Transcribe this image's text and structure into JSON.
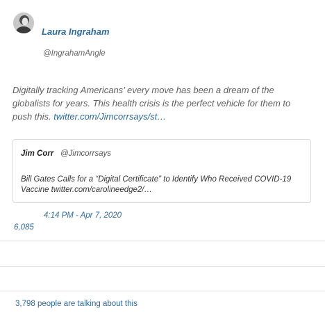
{
  "author": {
    "name": "Laura Ingraham",
    "handle": "@IngrahamAngle"
  },
  "tweet": {
    "text": "Digitally tracking Americans’ every move has been a dream of the globalists for years.  This health crisis is the perfect vehicle for them to push this. ",
    "link": "twitter.com/Jimcorrsays/st…"
  },
  "quoted_tweet": {
    "name": "Jim Corr",
    "handle": "@Jimcorrsays",
    "text": "Bill Gates Calls for a “Digital Certificate” to Identify Who Received COVID-19 Vaccine twitter.com/carolineedge2/…"
  },
  "meta": {
    "timestamp": "4:14 PM - Apr 7, 2020",
    "likes": "6,085"
  },
  "footer": {
    "talking": "3,798 people are talking about this"
  },
  "colors": {
    "link": "#2d6a9f",
    "body_text": "#5f5f5f",
    "divider": "#dedede"
  }
}
